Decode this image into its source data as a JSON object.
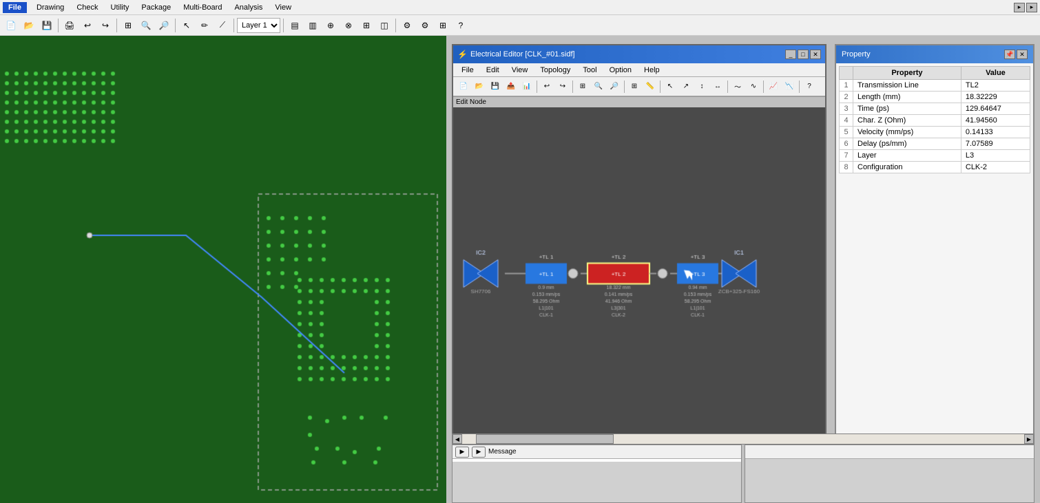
{
  "app": {
    "menu": [
      "File",
      "Drawing",
      "Check",
      "Utility",
      "Package",
      "Multi-Board",
      "Analysis",
      "View"
    ]
  },
  "elec_editor": {
    "title": "Electrical Editor [CLK_#01.sidf]",
    "menu": [
      "File",
      "Edit",
      "View",
      "Topology",
      "Tool",
      "Option",
      "Help"
    ],
    "edit_mode": "Edit  Node"
  },
  "property_panel": {
    "title": "Property",
    "rows": [
      {
        "num": "1",
        "property": "Transmission Line",
        "value": "TL2"
      },
      {
        "num": "2",
        "property": "Length (mm)",
        "value": "18.32229"
      },
      {
        "num": "3",
        "property": "Time (ps)",
        "value": "129.64647"
      },
      {
        "num": "4",
        "property": "Char. Z (Ohm)",
        "value": "41.94560"
      },
      {
        "num": "5",
        "property": "Velocity (mm/ps)",
        "value": "0.14133"
      },
      {
        "num": "6",
        "property": "Delay (ps/mm)",
        "value": "7.07589"
      },
      {
        "num": "7",
        "property": "Layer",
        "value": "L3"
      },
      {
        "num": "8",
        "property": "Configuration",
        "value": "CLK-2"
      }
    ],
    "col_property": "Property",
    "col_value": "Value"
  },
  "schematic": {
    "components": [
      {
        "id": "IC2",
        "label": "IC2",
        "type": "ic_left",
        "color": "#2060c0"
      },
      {
        "id": "TL1",
        "label": "+TL 1",
        "type": "tline",
        "color": "#2878e0",
        "sublabel": "0.9 mm\n0.153 mm/ps\n58.295 Ohm\nL1|101\nCLK-1"
      },
      {
        "id": "TL2",
        "label": "+TL 2",
        "type": "tline_red",
        "color": "#cc2222",
        "sublabel": "18.322 mm\n0.141 mm/ps\n41.946 Ohm\nL3|301\nCLK-2"
      },
      {
        "id": "TL3",
        "label": "+TL 3",
        "type": "tline",
        "color": "#2878e0",
        "sublabel": "0.94 mm\n0.153 mm/ps\n58.295 Ohm\nL1|101\nCLK-1"
      },
      {
        "id": "IC1",
        "label": "IC1",
        "type": "ic_right",
        "color": "#2060c0"
      }
    ],
    "ic2_part": "SH7706",
    "ic1_part": "ZCB+325-FS160"
  },
  "bottom": {
    "message_label": "Message"
  }
}
